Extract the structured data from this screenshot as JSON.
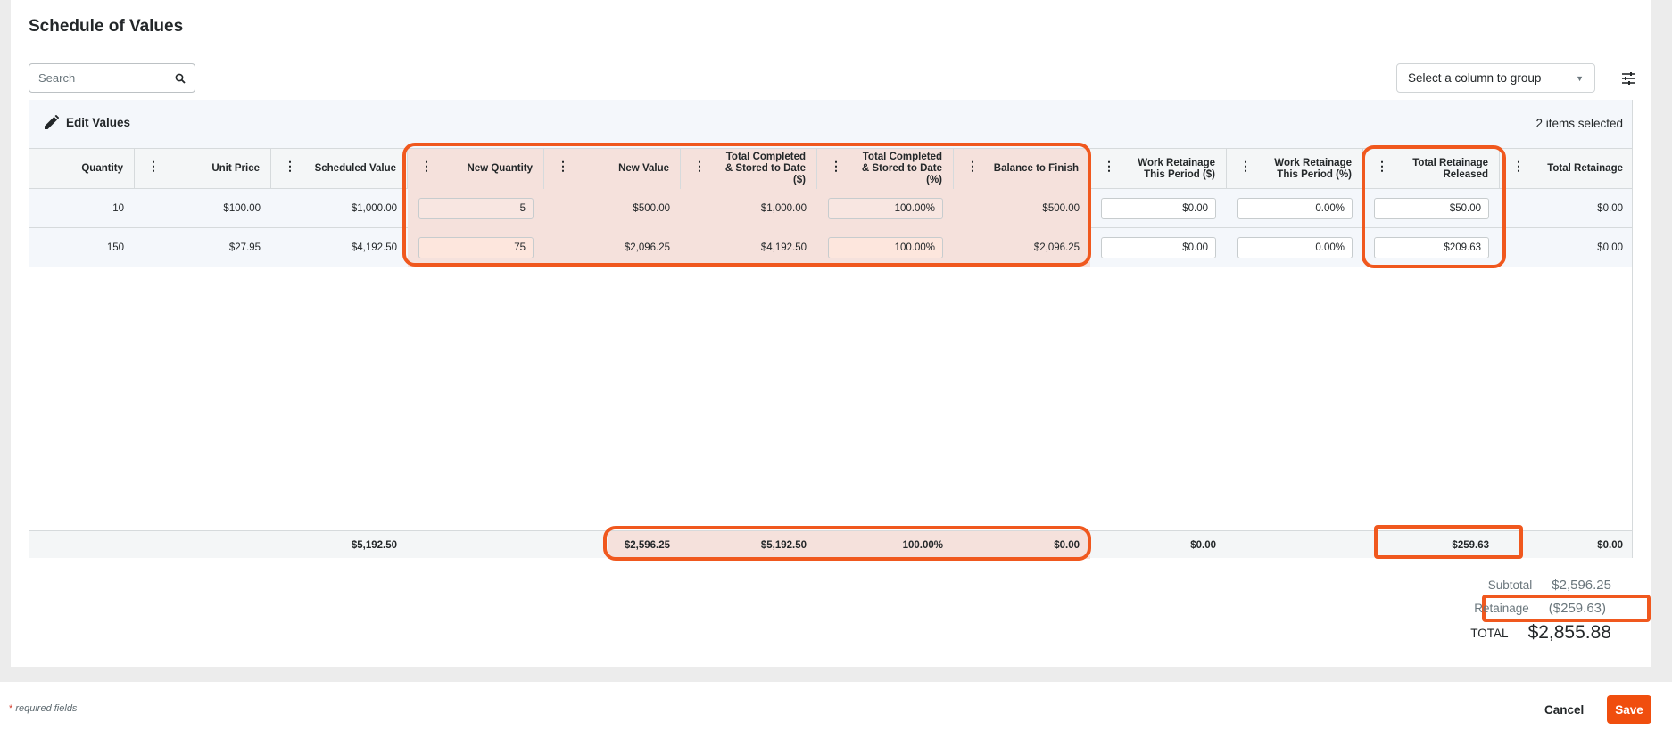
{
  "page": {
    "title": "Schedule of Values",
    "search_placeholder": "Search",
    "group_select": "Select a column to group",
    "edit_values_label": "Edit Values",
    "selected_count": "2 items selected"
  },
  "columns": [
    {
      "key": "quantity",
      "label": "Quantity"
    },
    {
      "key": "unit_price",
      "label": "Unit Price"
    },
    {
      "key": "scheduled_value",
      "label": "Scheduled Value"
    },
    {
      "key": "new_quantity",
      "label": "New Quantity"
    },
    {
      "key": "new_value",
      "label": "New Value"
    },
    {
      "key": "total_completed_dollar",
      "label": "Total Completed & Stored to Date ($)"
    },
    {
      "key": "total_completed_pct",
      "label": "Total Completed & Stored to Date (%)"
    },
    {
      "key": "balance_to_finish",
      "label": "Balance to Finish"
    },
    {
      "key": "work_retainage_dollar",
      "label": "Work Retainage This Period ($)"
    },
    {
      "key": "work_retainage_pct",
      "label": "Work Retainage This Period (%)"
    },
    {
      "key": "total_retainage_released",
      "label": "Total Retainage Released"
    },
    {
      "key": "total_retainage",
      "label": "Total Retainage"
    }
  ],
  "rows": [
    {
      "quantity": "10",
      "unit_price": "$100.00",
      "scheduled_value": "$1,000.00",
      "new_quantity": "5",
      "new_value": "$500.00",
      "total_completed_dollar": "$1,000.00",
      "total_completed_pct": "100.00%",
      "balance_to_finish": "$500.00",
      "work_retainage_dollar": "$0.00",
      "work_retainage_pct": "0.00%",
      "total_retainage_released": "$50.00",
      "total_retainage": "$0.00"
    },
    {
      "quantity": "150",
      "unit_price": "$27.95",
      "scheduled_value": "$4,192.50",
      "new_quantity": "75",
      "new_value": "$2,096.25",
      "total_completed_dollar": "$4,192.50",
      "total_completed_pct": "100.00%",
      "balance_to_finish": "$2,096.25",
      "work_retainage_dollar": "$0.00",
      "work_retainage_pct": "0.00%",
      "total_retainage_released": "$209.63",
      "total_retainage": "$0.00"
    }
  ],
  "totals": {
    "scheduled_value": "$5,192.50",
    "new_value": "$2,596.25",
    "total_completed_dollar": "$5,192.50",
    "total_completed_pct": "100.00%",
    "balance_to_finish": "$0.00",
    "work_retainage_dollar": "$0.00",
    "total_retainage_released": "$259.63",
    "total_retainage": "$0.00"
  },
  "summary": {
    "subtotal_label": "Subtotal",
    "subtotal_value": "$2,596.25",
    "retainage_label": "Retainage",
    "retainage_value": "($259.63)",
    "total_label": "TOTAL",
    "total_value": "$2,855.88"
  },
  "footer": {
    "required_star": "*",
    "required_text": " required fields",
    "cancel_label": "Cancel",
    "save_label": "Save"
  },
  "colors": {
    "accent": "#f04e0e",
    "highlight_outline": "#f0581e",
    "highlight_fill": "#f5e1dc"
  }
}
